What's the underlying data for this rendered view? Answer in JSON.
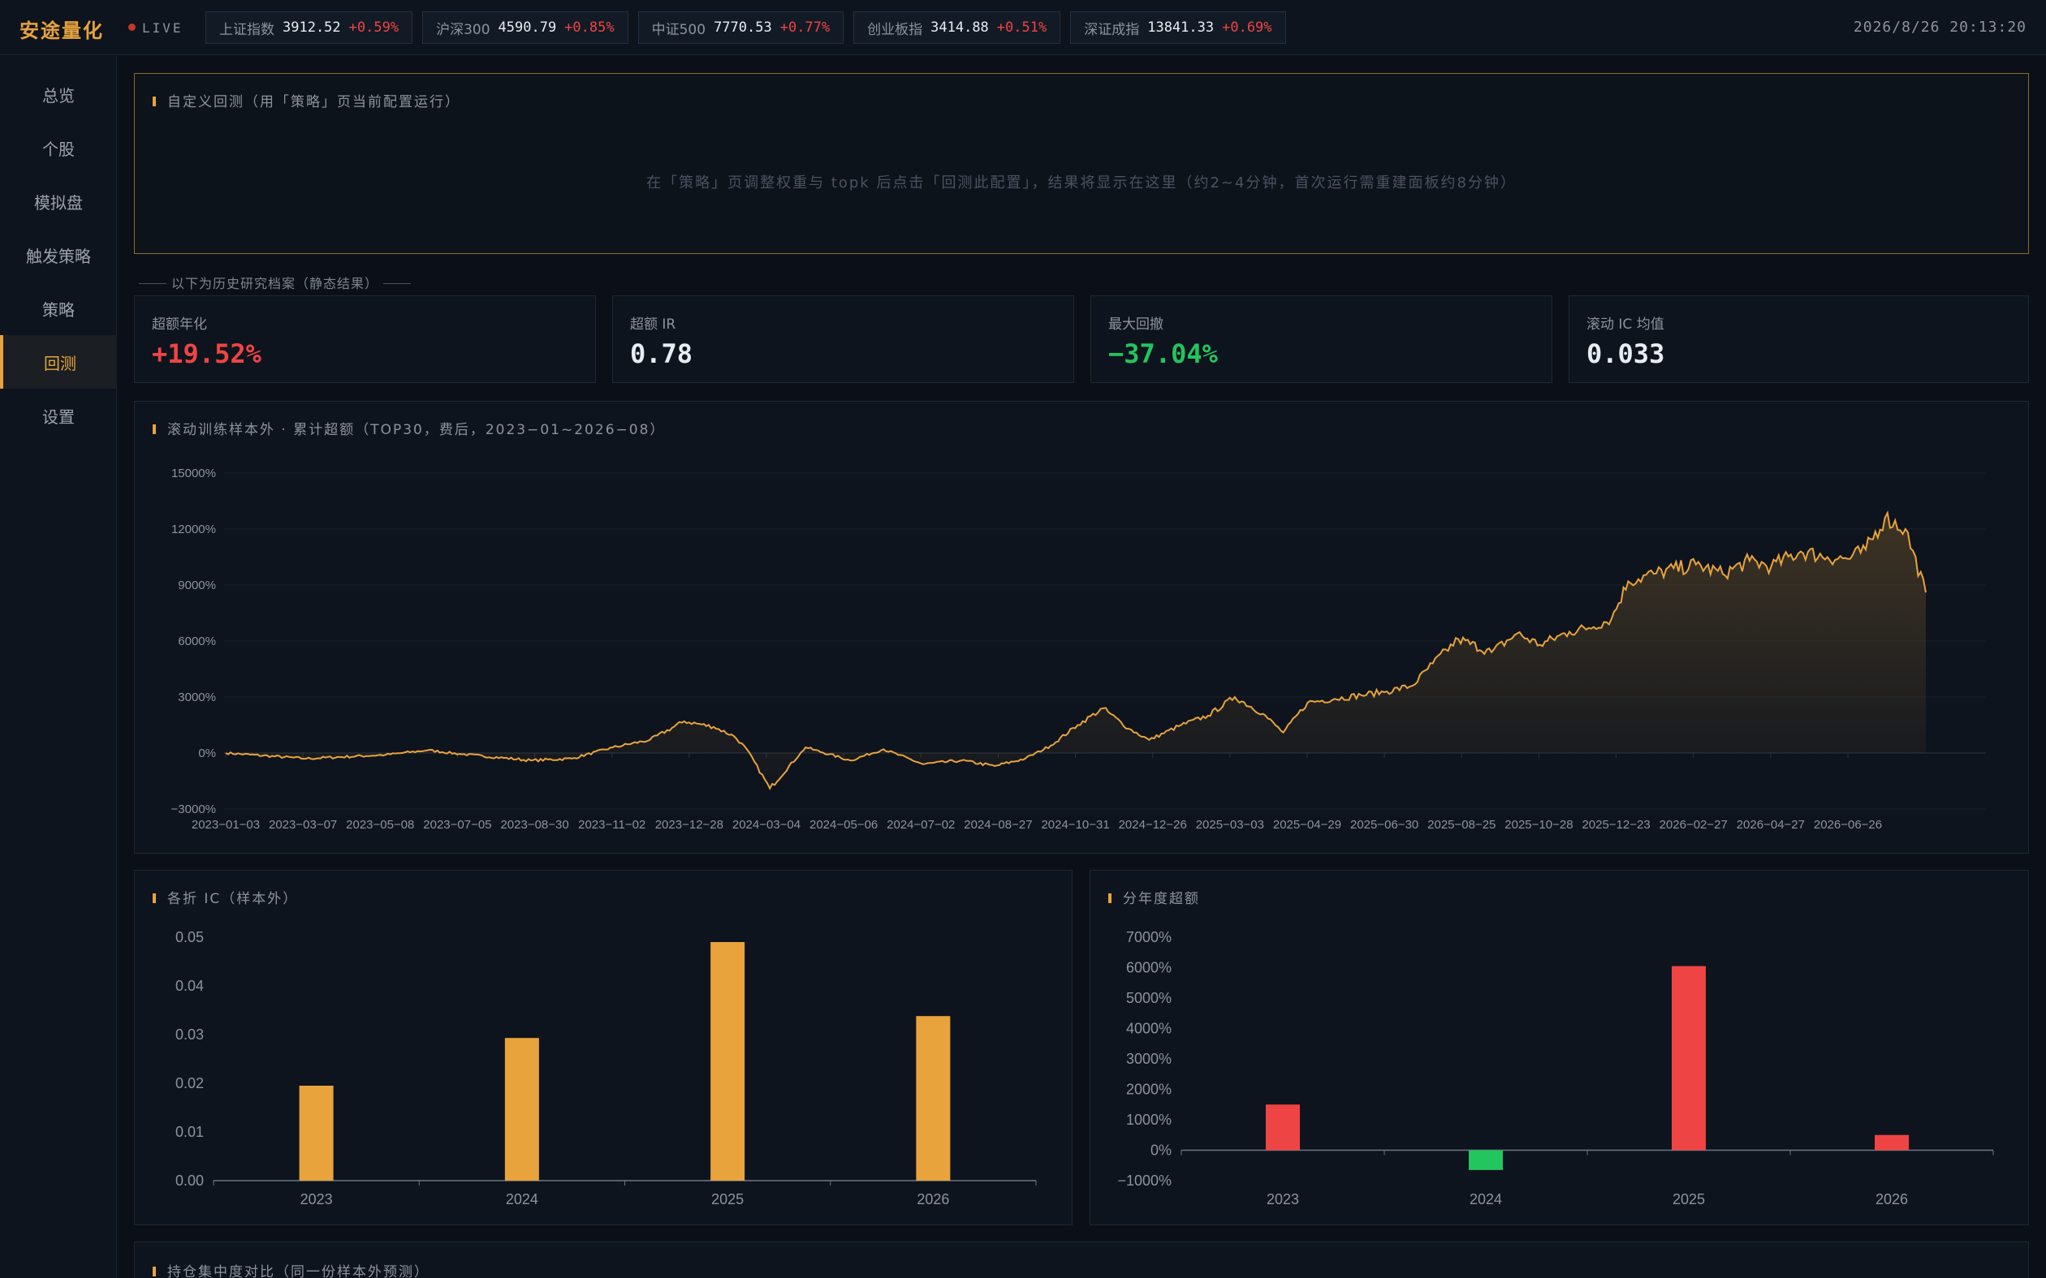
{
  "app": {
    "brand": "安途量化",
    "live": "LIVE",
    "clock": "2026/8/26 20:13:20"
  },
  "tickers": [
    {
      "name": "上证指数",
      "value": "3912.52",
      "change": "+0.59%"
    },
    {
      "name": "沪深300",
      "value": "4590.79",
      "change": "+0.85%"
    },
    {
      "name": "中证500",
      "value": "7770.53",
      "change": "+0.77%"
    },
    {
      "name": "创业板指",
      "value": "3414.88",
      "change": "+0.51%"
    },
    {
      "name": "深证成指",
      "value": "13841.33",
      "change": "+0.69%"
    }
  ],
  "sidebar": {
    "items": [
      {
        "label": "总览"
      },
      {
        "label": "个股"
      },
      {
        "label": "模拟盘"
      },
      {
        "label": "触发策略"
      },
      {
        "label": "策略"
      },
      {
        "label": "回测"
      },
      {
        "label": "设置"
      }
    ],
    "active_index": 5
  },
  "custom": {
    "title": "自定义回测（用「策略」页当前配置运行）",
    "hint": "在「策略」页调整权重与 topk 后点击「回测此配置」，结果将显示在这里（约2~4分钟，首次运行需重建面板约8分钟）"
  },
  "section_note": "以下为历史研究档案（静态结果）",
  "kpis": [
    {
      "label": "超额年化",
      "value": "+19.52%",
      "color": "#ef4444"
    },
    {
      "label": "超额 IR",
      "value": "0.78",
      "color": "#e6edf3"
    },
    {
      "label": "最大回撤",
      "value": "−37.04%",
      "color": "#22c55e"
    },
    {
      "label": "滚动 IC 均值",
      "value": "0.033",
      "color": "#e6edf3"
    }
  ],
  "panels": {
    "main_title": "滚动训练样本外 · 累计超额（TOP30，费后，2023−01~2026−08）",
    "ic_title": "各折 IC（样本外）",
    "yearly_title": "分年度超额",
    "hold_title": "持仓集中度对比（同一份样本外预测）"
  },
  "chart_data": [
    {
      "type": "area",
      "title": "滚动训练样本外 · 累计超额（TOP30，费后，2023−01~2026−08）",
      "y_unit": "%",
      "ylim": [
        -3000,
        15000
      ],
      "yticks": [
        "15000%",
        "12000%",
        "9000%",
        "6000%",
        "3000%",
        "0%",
        "−3000%"
      ],
      "xticks": [
        "2023−01−03",
        "2023−03−07",
        "2023−05−08",
        "2023−07−05",
        "2023−08−30",
        "2023−11−02",
        "2023−12−28",
        "2024−03−04",
        "2024−05−06",
        "2024−07−02",
        "2024−08−27",
        "2024−10−31",
        "2024−12−26",
        "2025−03−03",
        "2025−04−29",
        "2025−06−30",
        "2025−08−25",
        "2025−10−28",
        "2025−12−23",
        "2026−02−27",
        "2026−04−27",
        "2026−06−26"
      ],
      "color": "#e8a33d",
      "series": [
        {
          "x": [
            "2023−01−03",
            "2023−03−07",
            "2023−05−08",
            "2023−06−10",
            "2023−07−05",
            "2023−08−30",
            "2023−10−01",
            "2023−11−02",
            "2023−12−01",
            "2023−12−28",
            "2024−01−20",
            "2024−02−05",
            "2024−02−15",
            "2024−03−04",
            "2024−04−01",
            "2024−05−06",
            "2024−06−01",
            "2024−07−02",
            "2024−08−01",
            "2024−08−27",
            "2024−09−20",
            "2024−10−10",
            "2024−10−31",
            "2024−11−20",
            "2024−12−10",
            "2024−12−26",
            "2025−01−20",
            "2025−02−10",
            "2025−03−03",
            "2025−03−25",
            "2025−04−10",
            "2025−04−29",
            "2025−05−20",
            "2025−06−10",
            "2025−06−30",
            "2025−07−20",
            "2025−08−05",
            "2025−08−25",
            "2025−09−20",
            "2025−10−10",
            "2025−10−28",
            "2025−11−20",
            "2025−12−05",
            "2025−12−23",
            "2026−01−05",
            "2026−01−25",
            "2026−02−27",
            "2026−03−20",
            "2026−04−10",
            "2026−04−27",
            "2026−05−20",
            "2026−06−10",
            "2026−06−26",
            "2026−07−10",
            "2026−07−25",
            "2026−08−10",
            "2026−08−26"
          ],
          "y": [
            0,
            -300,
            -100,
            150,
            -50,
            -400,
            -300,
            300,
            700,
            1700,
            1400,
            900,
            200,
            -1900,
            300,
            -400,
            200,
            -600,
            -400,
            -700,
            -300,
            400,
            1500,
            2400,
            1300,
            700,
            1500,
            2000,
            3000,
            2100,
            1100,
            2700,
            2900,
            3100,
            3300,
            3600,
            4800,
            6100,
            5400,
            6400,
            5800,
            6500,
            6700,
            7200,
            9200,
            9600,
            10100,
            9600,
            10300,
            10000,
            10800,
            10500,
            10400,
            10900,
            12600,
            12000,
            8600
          ]
        }
      ]
    },
    {
      "type": "bar",
      "title": "各折 IC（样本外）",
      "categories": [
        "2023",
        "2024",
        "2025",
        "2026"
      ],
      "values": [
        0.0195,
        0.0293,
        0.049,
        0.0338
      ],
      "ylim": [
        0,
        0.05
      ],
      "yticks": [
        "0.05",
        "0.04",
        "0.03",
        "0.02",
        "0.01",
        "0.00"
      ],
      "color": "#e8a33d"
    },
    {
      "type": "bar",
      "title": "分年度超额",
      "categories": [
        "2023",
        "2024",
        "2025",
        "2026"
      ],
      "values": [
        1500,
        -650,
        6050,
        500
      ],
      "ylim": [
        -1000,
        7000
      ],
      "yticks": [
        "7000%",
        "6000%",
        "5000%",
        "4000%",
        "3000%",
        "2000%",
        "1000%",
        "0%",
        "−1000%"
      ],
      "pos_color": "#ef4444",
      "neg_color": "#22c55e"
    }
  ]
}
